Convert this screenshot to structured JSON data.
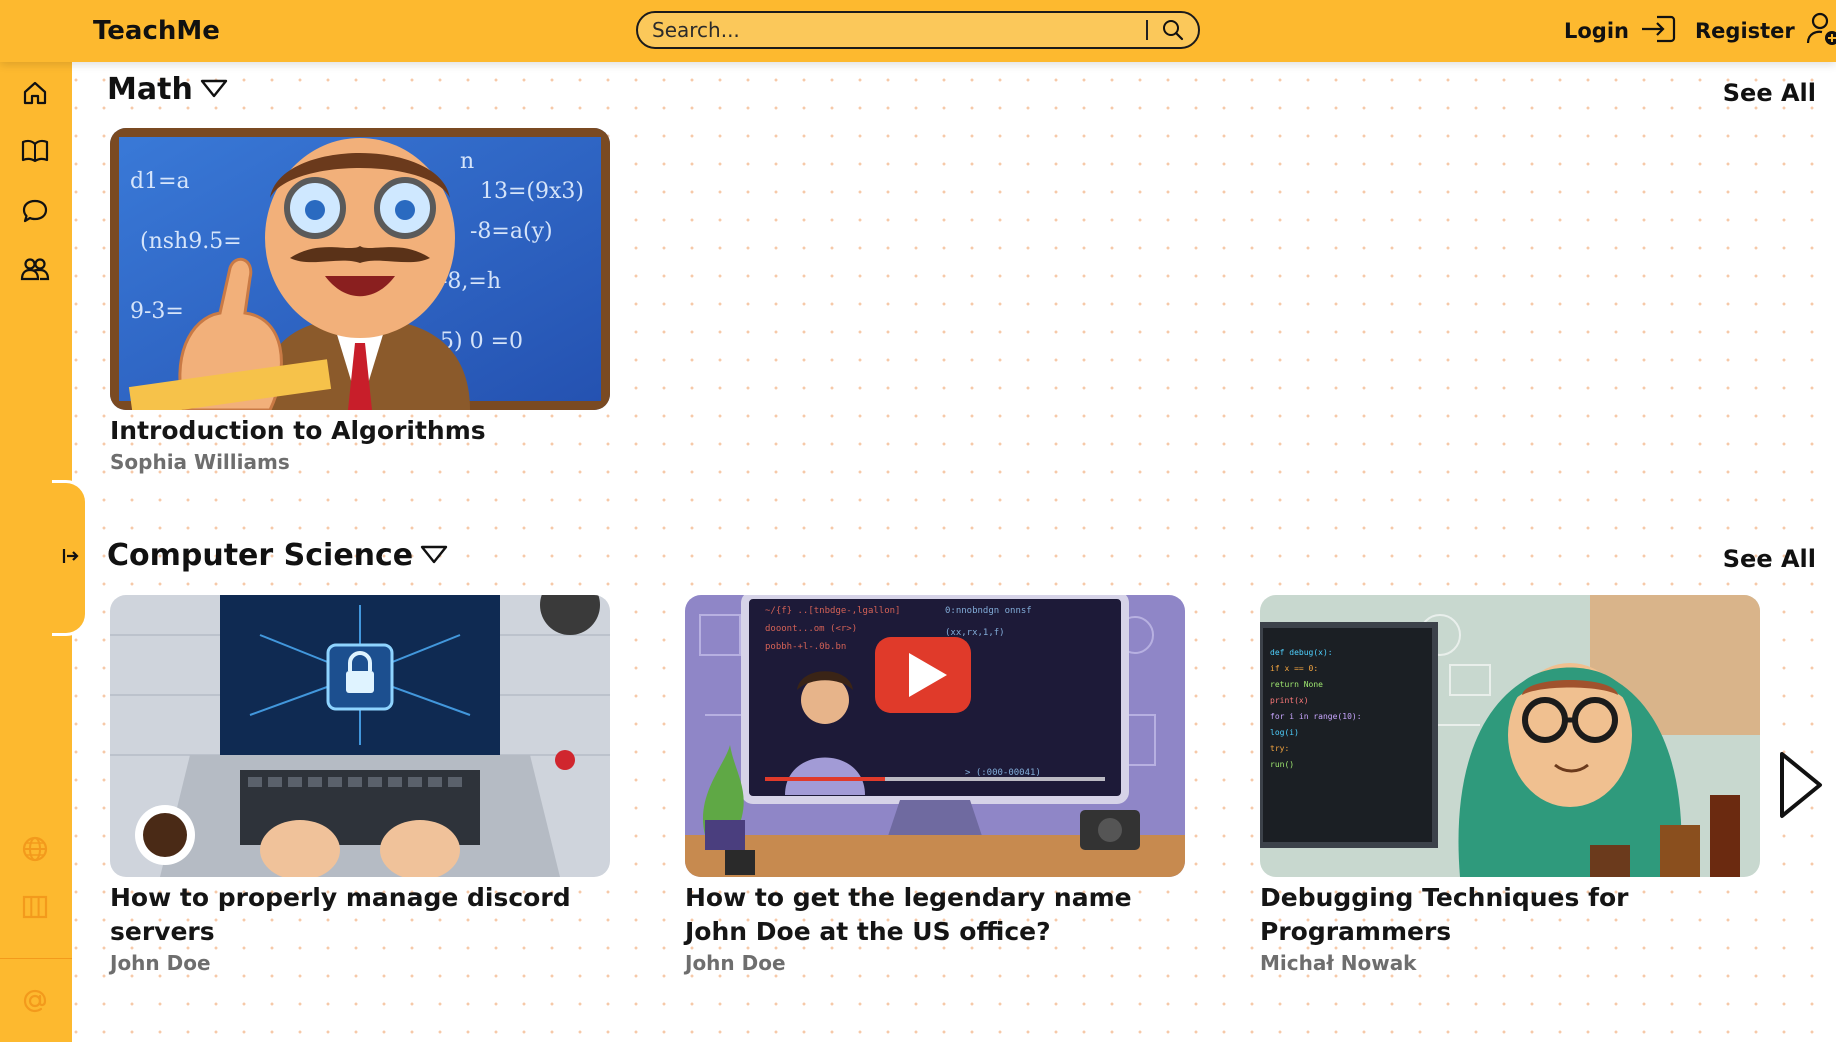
{
  "app": {
    "brand": "TeachMe"
  },
  "search": {
    "placeholder": "Search..."
  },
  "auth": {
    "login_label": "Login",
    "register_label": "Register"
  },
  "sidebar": {
    "items": [
      {
        "icon": "home-icon"
      },
      {
        "icon": "book-icon"
      },
      {
        "icon": "chat-icon"
      },
      {
        "icon": "users-icon"
      },
      {
        "icon": "globe-icon"
      },
      {
        "icon": "library-icon"
      },
      {
        "icon": "at-icon"
      }
    ]
  },
  "sections": [
    {
      "title": "Math",
      "see_all": "See All",
      "cards": [
        {
          "title": "Introduction to Algorithms",
          "author": "Sophia Williams"
        }
      ]
    },
    {
      "title": "Computer Science",
      "see_all": "See All",
      "cards": [
        {
          "title": "How to properly manage discord servers",
          "author": "John Doe"
        },
        {
          "title": "How to get the legendary name John Doe at the US office?",
          "author": "John Doe"
        },
        {
          "title": "Debugging Techniques for Programmers",
          "author": "Michał Nowak"
        }
      ]
    }
  ],
  "colors": {
    "accent": "#fdb92f",
    "search_bg": "#fbc85a",
    "author_gray": "#6e6e6e"
  }
}
